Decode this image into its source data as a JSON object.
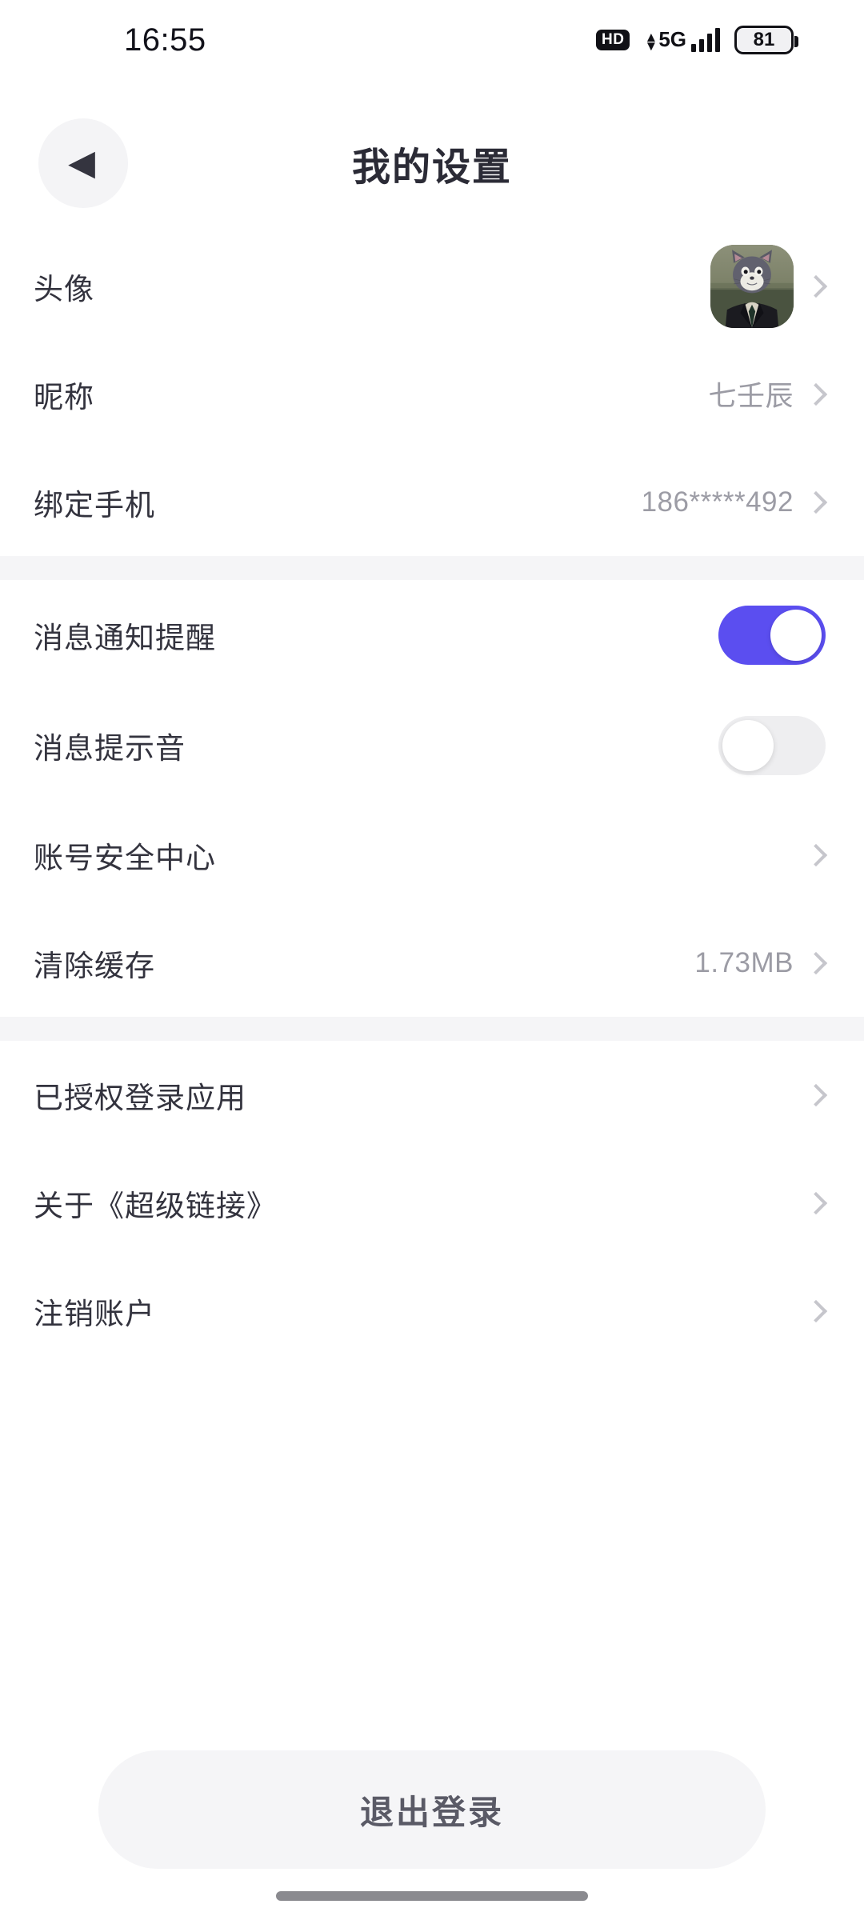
{
  "status_bar": {
    "time": "16:55",
    "hd_label": "HD",
    "network_label": "5G",
    "battery_level": "81",
    "signal_bars": 4
  },
  "header": {
    "title": "我的设置",
    "back_icon": "back-chevron-icon"
  },
  "sections": [
    {
      "rows": [
        {
          "label": "头像",
          "value": "",
          "type": "avatar",
          "chevron": true
        },
        {
          "label": "昵称",
          "value": "七壬辰",
          "type": "value",
          "chevron": true
        },
        {
          "label": "绑定手机",
          "value": "186*****492",
          "type": "value",
          "chevron": true
        }
      ]
    },
    {
      "rows": [
        {
          "label": "消息通知提醒",
          "value": "",
          "type": "switch",
          "switch_on": true
        },
        {
          "label": "消息提示音",
          "value": "",
          "type": "switch",
          "switch_on": false
        },
        {
          "label": "账号安全中心",
          "value": "",
          "type": "value",
          "chevron": true
        },
        {
          "label": "清除缓存",
          "value": "1.73MB",
          "type": "value",
          "chevron": true
        }
      ]
    },
    {
      "rows": [
        {
          "label": "已授权登录应用",
          "value": "",
          "type": "value",
          "chevron": true
        },
        {
          "label": "关于《超级链接》",
          "value": "",
          "type": "value",
          "chevron": true
        },
        {
          "label": "注销账户",
          "value": "",
          "type": "value",
          "chevron": true
        }
      ]
    }
  ],
  "logout": {
    "label": "退出登录"
  },
  "colors": {
    "accent_on": "#5B4EF0",
    "track_off": "#EEEEF0",
    "band": "#F5F5F7",
    "text_primary": "#33333E",
    "text_secondary": "#9C9CA5",
    "chevron": "#C6C6CC",
    "logout_bg": "#F5F5F7",
    "logout_text": "#5A5A66"
  }
}
